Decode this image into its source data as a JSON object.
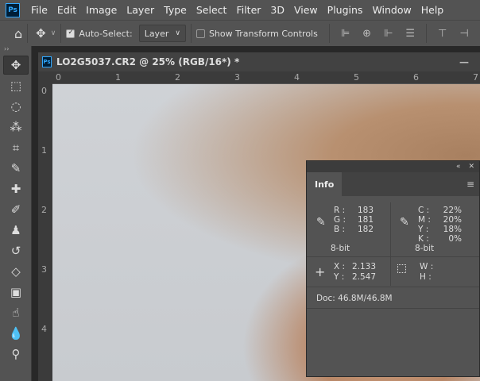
{
  "menubar": {
    "logo": "Ps",
    "items": [
      "File",
      "Edit",
      "Image",
      "Layer",
      "Type",
      "Select",
      "Filter",
      "3D",
      "View",
      "Plugins",
      "Window",
      "Help"
    ]
  },
  "options": {
    "auto_select_label": "Auto-Select:",
    "auto_select_checked": true,
    "layer_select": "Layer",
    "show_transform_label": "Show Transform Controls",
    "show_transform_checked": false
  },
  "document": {
    "tab_title": "LO2G5037.CR2 @ 25% (RGB/16*) *",
    "hruler": [
      "0",
      "1",
      "2",
      "3",
      "4",
      "5",
      "6",
      "7"
    ],
    "vruler": [
      "0",
      "1",
      "2",
      "3",
      "4"
    ]
  },
  "info": {
    "tab": "Info",
    "rgb": {
      "labels": [
        "R :",
        "G :",
        "B :"
      ],
      "values": [
        "183",
        "181",
        "182"
      ],
      "bits": "8-bit"
    },
    "cmyk": {
      "labels": [
        "C :",
        "M :",
        "Y :",
        "K :"
      ],
      "values": [
        "22%",
        "20%",
        "18%",
        "0%"
      ],
      "bits": "8-bit"
    },
    "xy": {
      "labels": [
        "X :",
        "Y :"
      ],
      "values": [
        "2.133",
        "2.547"
      ]
    },
    "wh": {
      "labels": [
        "W :",
        "H :"
      ]
    },
    "doc": "Doc: 46.8M/46.8M"
  }
}
